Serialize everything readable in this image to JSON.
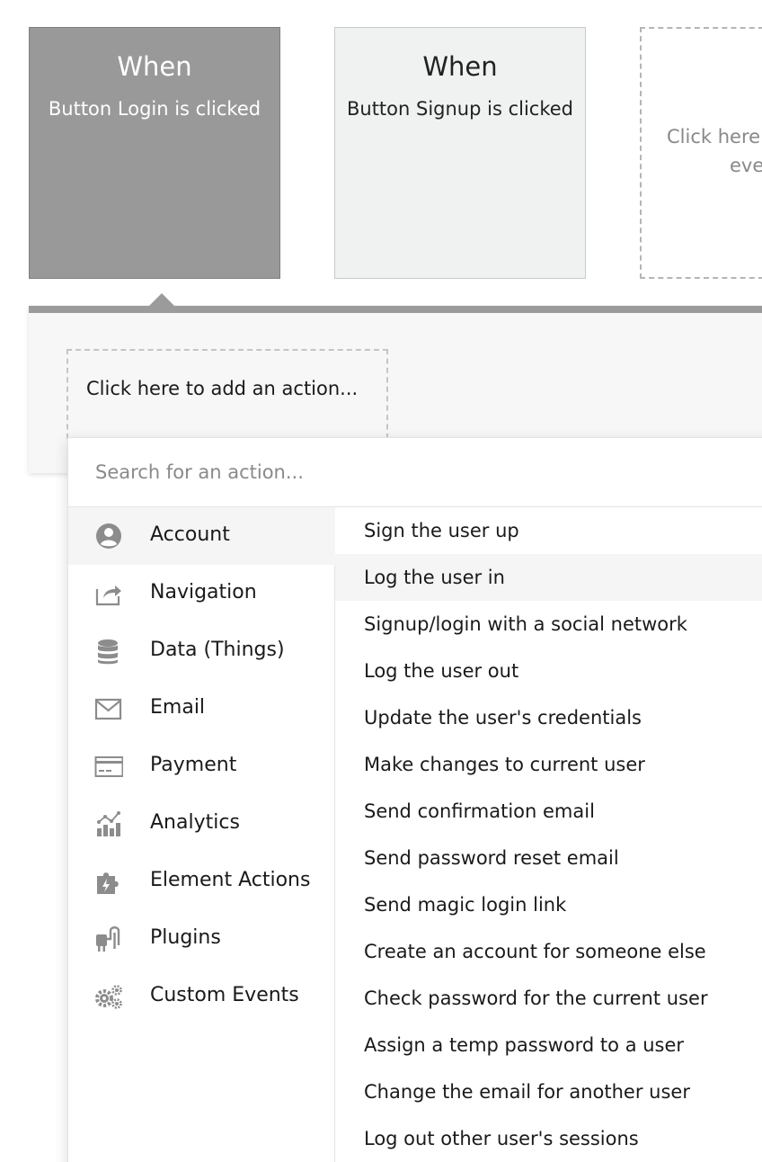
{
  "events": {
    "login": {
      "when": "When",
      "description": "Button Login is clicked"
    },
    "signup": {
      "when": "When",
      "description": "Button Signup is clicked"
    },
    "add": {
      "line1": "Click here",
      "line2": "eve"
    }
  },
  "panel": {
    "add_action_label": "Click here to add an action..."
  },
  "dropdown": {
    "search_placeholder": "Search for an action...",
    "categories": [
      {
        "label": "Account",
        "icon": "account-icon"
      },
      {
        "label": "Navigation",
        "icon": "navigation-icon"
      },
      {
        "label": "Data (Things)",
        "icon": "database-icon"
      },
      {
        "label": "Email",
        "icon": "email-icon"
      },
      {
        "label": "Payment",
        "icon": "payment-icon"
      },
      {
        "label": "Analytics",
        "icon": "analytics-icon"
      },
      {
        "label": "Element Actions",
        "icon": "puzzle-icon"
      },
      {
        "label": "Plugins",
        "icon": "plug-icon"
      },
      {
        "label": "Custom Events",
        "icon": "gears-icon"
      }
    ],
    "active_category": "Account",
    "actions": [
      "Sign the user up",
      "Log the user in",
      "Signup/login with a social network",
      "Log the user out",
      "Update the user's credentials",
      "Make changes to current user",
      "Send confirmation email",
      "Send password reset email",
      "Send magic login link",
      "Create an account for someone else",
      "Check password for the current user",
      "Assign a temp password to a user",
      "Change the email for another user",
      "Log out other user's sessions"
    ],
    "highlighted_action": "Log the user in"
  },
  "colors": {
    "selected_event_bg": "#999999",
    "event_bg": "#f0f2f1",
    "panel_bar": "#9b9b9b",
    "icon_gray": "#8c8c8c"
  }
}
